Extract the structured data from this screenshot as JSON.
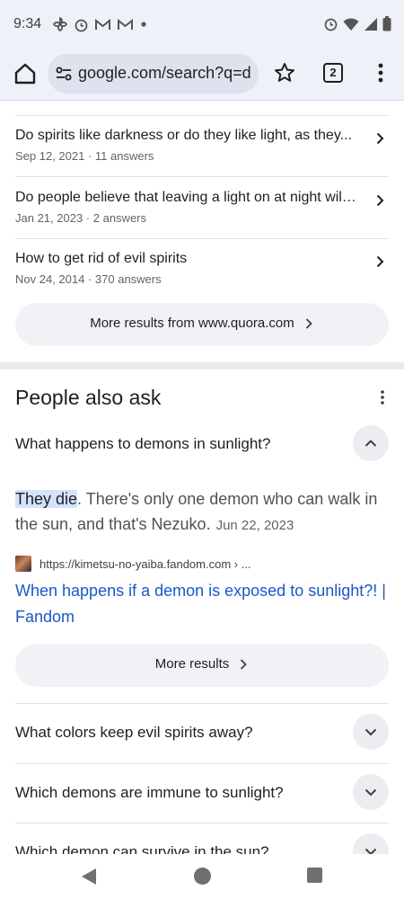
{
  "status_bar": {
    "time": "9:34",
    "left_icons": [
      "pinwheel-icon",
      "alarm-icon",
      "gmail-icon",
      "gmail-icon",
      "dot-icon"
    ],
    "right_icons": [
      "alarm-icon",
      "wifi-icon",
      "signal-icon",
      "battery-icon"
    ]
  },
  "toolbar": {
    "url": "google.com/search?q=d",
    "tab_count": "2"
  },
  "quora_results": [
    {
      "title": "Do spirits like darkness or do they like light, as they...",
      "date": "Sep 12, 2021",
      "answers": "11 answers"
    },
    {
      "title": "Do people believe that leaving a light on at night will...",
      "date": "Jan 21, 2023",
      "answers": "2 answers"
    },
    {
      "title": "How to get rid of evil spirits",
      "date": "Nov 24, 2014",
      "answers": "370 answers"
    }
  ],
  "more_from_quora": "More results from www.quora.com",
  "people_also_ask": {
    "title": "People also ask",
    "expanded_question": "What happens to demons in sunlight?",
    "answer_highlight": "They die",
    "answer_rest": ". There's only one demon who can walk in the sun, and that's Nezuko.",
    "answer_date": "Jun 22, 2023",
    "source_url": "https://kimetsu-no-yaiba.fandom.com › ...",
    "source_title": "When happens if a demon is exposed to sunlight?! | Fandom",
    "more_results": "More results",
    "questions": [
      "What colors keep evil spirits away?",
      "Which demons are immune to sunlight?",
      "Which demon can survive in the sun?"
    ]
  },
  "colors": {
    "link": "#1a57c8",
    "highlight": "#d3e3fd",
    "chrome_bg": "#eef1f8"
  }
}
